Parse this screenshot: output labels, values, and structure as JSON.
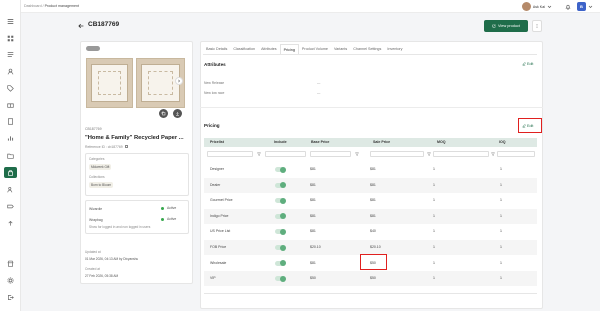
{
  "breadcrumb": {
    "parent": "Dashboard",
    "sep": "/",
    "current": "Product management"
  },
  "user": {
    "name": "Ask Kai"
  },
  "app_badge": "B",
  "page": {
    "title": "CB187769",
    "view_button": "View product"
  },
  "product": {
    "sku": "CB187769",
    "name": "\"Home & Family\" Recycled Paper ...",
    "reference": "Reference ID : cb187769",
    "categories_label": "Categories",
    "category": "Midweek Gift",
    "collections_label": "Collections",
    "collection": "Born to Bloom",
    "websites": [
      {
        "name": "Wizardie",
        "status": "Active"
      },
      {
        "name": "Wrapbag",
        "status": "Active"
      }
    ],
    "guest_note": "Show for logged in and non logged in users",
    "updated_label": "Updated at",
    "updated_value": "01 Mar 2026, 04:13 AM by Divyanshu",
    "created_label": "Created at",
    "created_value": "27 Feb 2026, 05:38 AM"
  },
  "tabs": [
    "Basic Details",
    "Classification",
    "Attributes",
    "Pricing",
    "Product Volume",
    "Variants",
    "Channel Settings",
    "Inventory"
  ],
  "active_tab": "Pricing",
  "attributes": {
    "title": "Attributes",
    "edit": "Edit",
    "rows": [
      {
        "label": "New Release",
        "value": "---"
      },
      {
        "label": "New low race",
        "value": "---"
      }
    ]
  },
  "pricing": {
    "title": "Pricing",
    "edit": "Edit",
    "columns": [
      "Pricelist",
      "Include",
      "Base Price",
      "Sale Price",
      "MOQ",
      "IOQ"
    ],
    "rows": [
      {
        "pricelist": "Designer",
        "include": true,
        "base": "$81",
        "sale": "$81",
        "moq": "1",
        "ioq": "1"
      },
      {
        "pricelist": "Dealer",
        "include": true,
        "base": "$81",
        "sale": "$81",
        "moq": "1",
        "ioq": "1"
      },
      {
        "pricelist": "Gourmet Price",
        "include": true,
        "base": "$81",
        "sale": "$81",
        "moq": "1",
        "ioq": "1"
      },
      {
        "pricelist": "Indigo Price",
        "include": true,
        "base": "$81",
        "sale": "$81",
        "moq": "1",
        "ioq": "1"
      },
      {
        "pricelist": "US Price List",
        "include": true,
        "base": "$81",
        "sale": "$40",
        "moq": "1",
        "ioq": "1"
      },
      {
        "pricelist": "FOB Price",
        "include": true,
        "base": "$20.10",
        "sale": "$20.10",
        "moq": "1",
        "ioq": "1"
      },
      {
        "pricelist": "Wholesale",
        "include": true,
        "base": "$81",
        "sale": "$50",
        "moq": "1",
        "ioq": "1"
      },
      {
        "pricelist": "VIP",
        "include": true,
        "base": "$50",
        "sale": "$50",
        "moq": "1",
        "ioq": "1"
      }
    ]
  },
  "colors": {
    "brand": "#1f6d4a",
    "highlight": "#e0201f",
    "header_bg": "#dee9e4"
  }
}
